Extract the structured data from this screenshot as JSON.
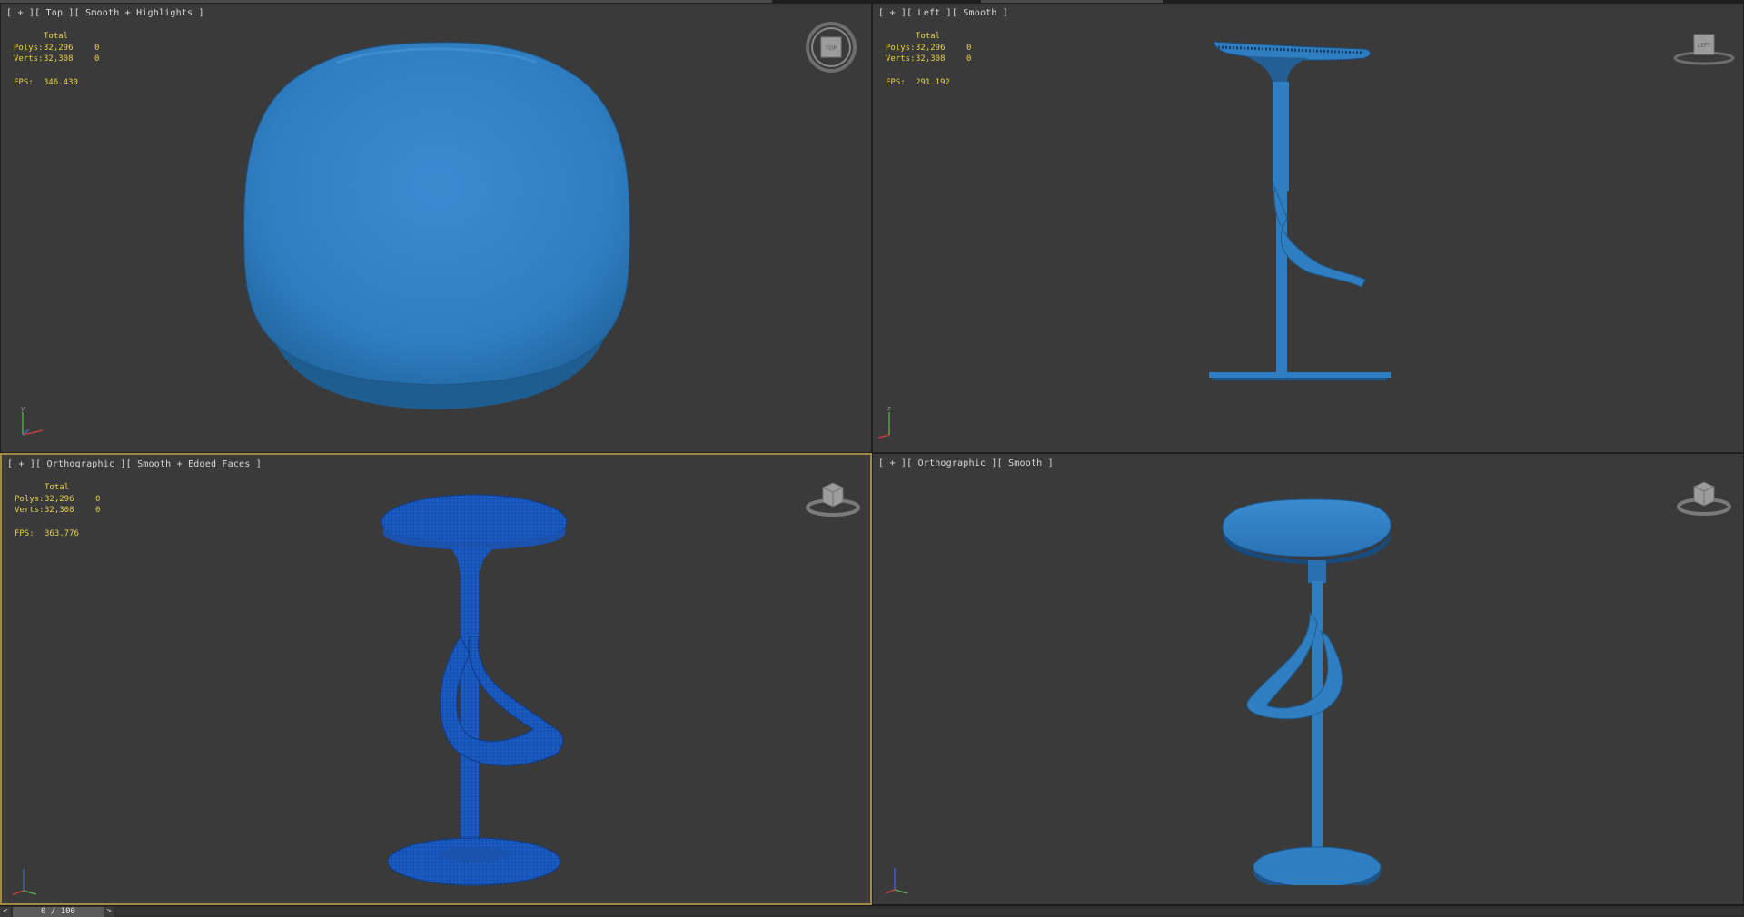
{
  "viewports": [
    {
      "id": "top",
      "label": "[ + ][ Top ][ Smooth + Highlights ]",
      "stats": {
        "header": "Total",
        "polys_label": "Polys:",
        "polys_total": "32,296",
        "polys_sel": "0",
        "verts_label": "Verts:",
        "verts_total": "32,308",
        "verts_sel": "0",
        "fps_label": "FPS:",
        "fps": "346.430"
      },
      "viewcube": "TOP"
    },
    {
      "id": "left",
      "label": "[ + ][ Left ][ Smooth ]",
      "stats": {
        "header": "Total",
        "polys_label": "Polys:",
        "polys_total": "32,296",
        "polys_sel": "0",
        "verts_label": "Verts:",
        "verts_total": "32,308",
        "verts_sel": "0",
        "fps_label": "FPS:",
        "fps": "291.192"
      },
      "viewcube": "LEFT"
    },
    {
      "id": "ortho-edged",
      "label": "[ + ][ Orthographic ][ Smooth + Edged Faces ]",
      "stats": {
        "header": "Total",
        "polys_label": "Polys:",
        "polys_total": "32,296",
        "polys_sel": "0",
        "verts_label": "Verts:",
        "verts_total": "32,308",
        "verts_sel": "0",
        "fps_label": "FPS:",
        "fps": "363.776"
      }
    },
    {
      "id": "ortho-smooth",
      "label": "[ + ][ Orthographic ][ Smooth ]"
    }
  ],
  "timeline": {
    "prev": "<",
    "next": ">",
    "frame": "0 / 100"
  },
  "colors": {
    "model": "#2f7fc4",
    "model_dark": "#1d5f9e",
    "model_wire": "#1a56b8",
    "viewport_bg": "#3a3a3a",
    "active_border": "#a08a45",
    "stats_text": "#e7d24a"
  }
}
